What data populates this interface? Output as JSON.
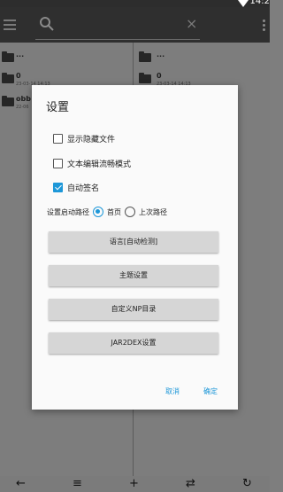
{
  "status_bar": {
    "time": "14:2"
  },
  "toolbar": {
    "search_placeholder": "",
    "clear_symbol": "×"
  },
  "left_panel": {
    "items": [
      {
        "name": "...",
        "date": ""
      },
      {
        "name": "0",
        "date": "23-03-14 14:13"
      },
      {
        "name": "obb",
        "date": "22-06"
      }
    ]
  },
  "right_panel": {
    "items": [
      {
        "name": "...",
        "date": ""
      },
      {
        "name": "0",
        "date": "23-03-14 14:13"
      }
    ]
  },
  "dialog": {
    "title": "设置",
    "options": [
      {
        "label": "显示隐藏文件",
        "checked": false
      },
      {
        "label": "文本编辑流畅模式",
        "checked": false
      },
      {
        "label": "自动签名",
        "checked": true
      }
    ],
    "start_path": {
      "label": "设置启动路径",
      "choices": [
        {
          "label": "首页",
          "selected": true
        },
        {
          "label": "上次路径",
          "selected": false
        }
      ]
    },
    "buttons": [
      "语言[自动检测]",
      "主题设置",
      "自定义NP目录",
      "JAR2DEX设置"
    ],
    "cancel": "取消",
    "ok": "确定"
  },
  "bottom_bar": {
    "icons": [
      "back-arrow-icon",
      "list-icon",
      "add-icon",
      "swap-icon",
      "refresh-icon"
    ]
  },
  "colors": {
    "accent": "#1d97d8",
    "toolbar": "#2f2f2f",
    "dim_background": "#7d7d7d"
  }
}
